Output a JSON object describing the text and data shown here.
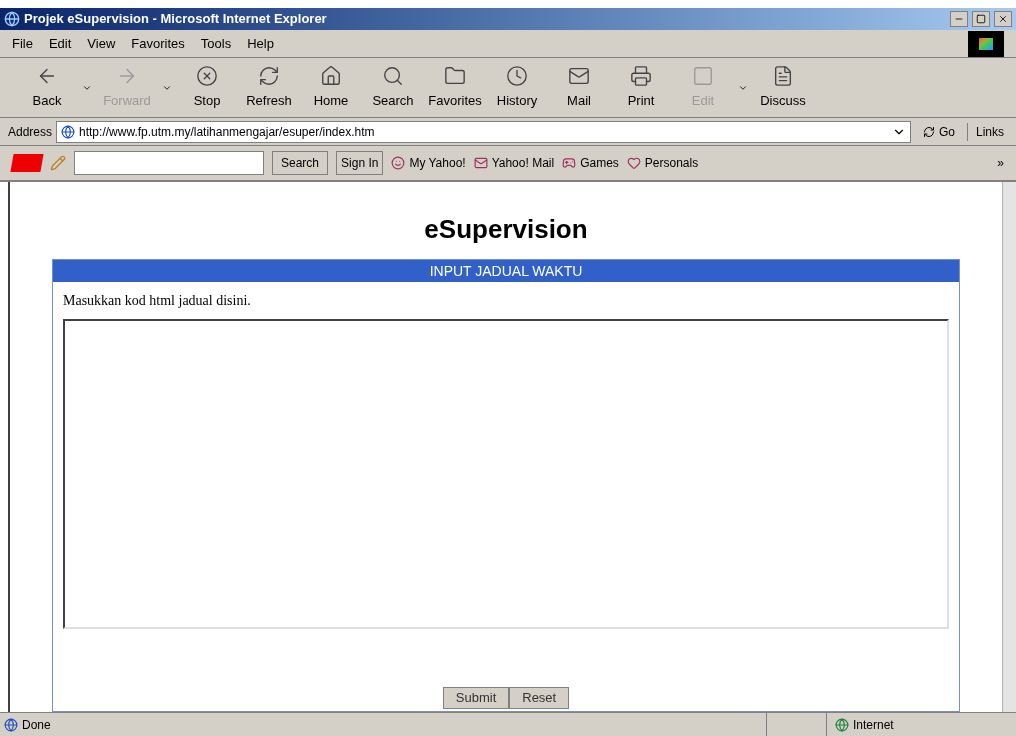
{
  "window": {
    "title": "Projek eSupervision - Microsoft Internet Explorer"
  },
  "menu": [
    "File",
    "Edit",
    "View",
    "Favorites",
    "Tools",
    "Help"
  ],
  "toolbar": [
    {
      "label": "Back",
      "kind": "back",
      "disabled": false,
      "dropdown": true
    },
    {
      "label": "Forward",
      "kind": "forward",
      "disabled": true,
      "dropdown": true
    },
    {
      "label": "Stop",
      "kind": "stop",
      "disabled": false,
      "dropdown": false
    },
    {
      "label": "Refresh",
      "kind": "refresh",
      "disabled": false,
      "dropdown": false
    },
    {
      "label": "Home",
      "kind": "home",
      "disabled": false,
      "dropdown": false
    },
    {
      "label": "Search",
      "kind": "search",
      "disabled": false,
      "dropdown": false
    },
    {
      "label": "Favorites",
      "kind": "favorites",
      "disabled": false,
      "dropdown": false
    },
    {
      "label": "History",
      "kind": "history",
      "disabled": false,
      "dropdown": false
    },
    {
      "label": "Mail",
      "kind": "mail",
      "disabled": false,
      "dropdown": false
    },
    {
      "label": "Print",
      "kind": "print",
      "disabled": false,
      "dropdown": false
    },
    {
      "label": "Edit",
      "kind": "edit",
      "disabled": true,
      "dropdown": true
    },
    {
      "label": "Discuss",
      "kind": "discuss",
      "disabled": false,
      "dropdown": false
    }
  ],
  "address": {
    "label": "Address",
    "value": "http://www.fp.utm.my/latihanmengajar/esuper/index.htm",
    "go": "Go",
    "links": "Links"
  },
  "yahoo_bar": {
    "search_button": "Search",
    "sign_in": "Sign In",
    "links": [
      "My Yahoo!",
      "Yahoo! Mail",
      "Games",
      "Personals"
    ],
    "more": "»"
  },
  "page": {
    "heading": "eSupervision",
    "panel_title": "INPUT JADUAL WAKTU",
    "instruction": "Masukkan kod html jadual disini.",
    "buttons": [
      "Submit",
      "Reset"
    ]
  },
  "status_bar": {
    "text": "Done",
    "zone": "Internet"
  }
}
